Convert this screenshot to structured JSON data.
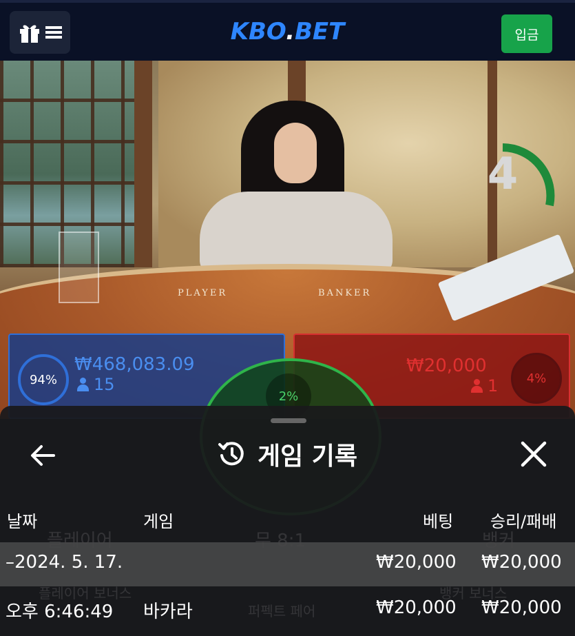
{
  "header": {
    "logo_main": "KBO",
    "logo_dot": ".",
    "logo_suffix": "BET",
    "deposit_label": "입금",
    "colors": {
      "background": "#0a1126",
      "logo": "#2e86ff",
      "deposit": "#17a34a"
    }
  },
  "table": {
    "player_label": "PLAYER",
    "banker_label": "BANKER",
    "countdown": "4"
  },
  "bets": {
    "player": {
      "percent": "94%",
      "percent_value": 94,
      "amount": "₩468,083.09",
      "players": "15",
      "color": "#2f6fd8"
    },
    "tie": {
      "percent": "2%",
      "percent_value": 2,
      "color": "#2fb44a"
    },
    "banker": {
      "percent": "4%",
      "percent_value": 4,
      "amount": "₩20,000",
      "players": "1",
      "color": "#d83030"
    }
  },
  "history": {
    "title": "게임 기록",
    "columns": {
      "date": "날짜",
      "game": "게임",
      "bet": "베팅",
      "win_loss": "승리/패배"
    },
    "date_group": {
      "date": "–2024. 5. 17.",
      "bet": "₩20,000",
      "win_loss": "₩20,000"
    },
    "entry": {
      "time": "오후 6:46:49",
      "game": "바카라",
      "bet": "₩20,000",
      "win_loss": "₩20,000"
    },
    "background_labels": {
      "player": "플레이어",
      "tie": "무 8:1",
      "banker": "뱅커",
      "player_bonus": "플레이어 보너스",
      "perfect_pair": "퍼펙트 페어",
      "banker_bonus": "뱅커 보너스"
    }
  },
  "icons": [
    "gift-icon",
    "hamburger-icon",
    "back-arrow-icon",
    "history-icon",
    "close-icon",
    "person-icon"
  ]
}
